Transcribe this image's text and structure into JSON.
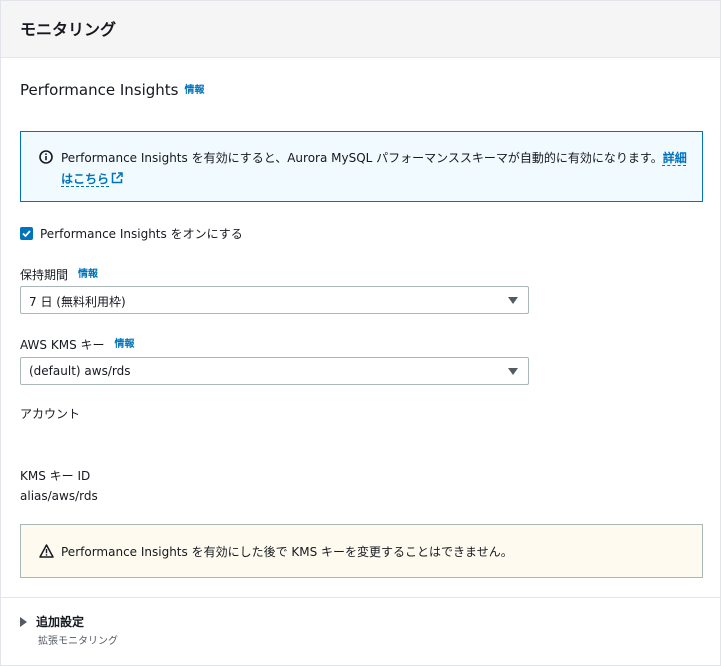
{
  "panel": {
    "title": "モニタリング"
  },
  "performance_insights": {
    "title": "Performance Insights",
    "info_label": "情報",
    "alert": {
      "text": "Performance Insights を有効にすると、Aurora MySQL パフォーマンススキーマが自動的に有効になります。",
      "link": "詳細はこちら"
    },
    "checkbox": {
      "label": "Performance Insights をオンにする",
      "checked": true
    }
  },
  "retention": {
    "label": "保持期間",
    "info_label": "情報",
    "value": "7 日 (無料利用枠)"
  },
  "kms": {
    "label": "AWS KMS キー",
    "info_label": "情報",
    "value": "(default) aws/rds"
  },
  "account": {
    "label": "アカウント"
  },
  "kms_key_id": {
    "label": "KMS キー ID",
    "value": "alias/aws/rds"
  },
  "warning": {
    "text": "Performance Insights を有効にした後で KMS キーを変更することはできません。"
  },
  "additional": {
    "title": "追加設定",
    "description": "拡張モニタリング"
  },
  "colors": {
    "link": "#0073bb",
    "info_bg": "#f1faff",
    "warn_bg": "#fffaf0"
  },
  "icons": [
    "info-icon",
    "external-link-icon",
    "checkmark-icon",
    "caret-down-icon",
    "warning-icon",
    "caret-right-icon"
  ]
}
